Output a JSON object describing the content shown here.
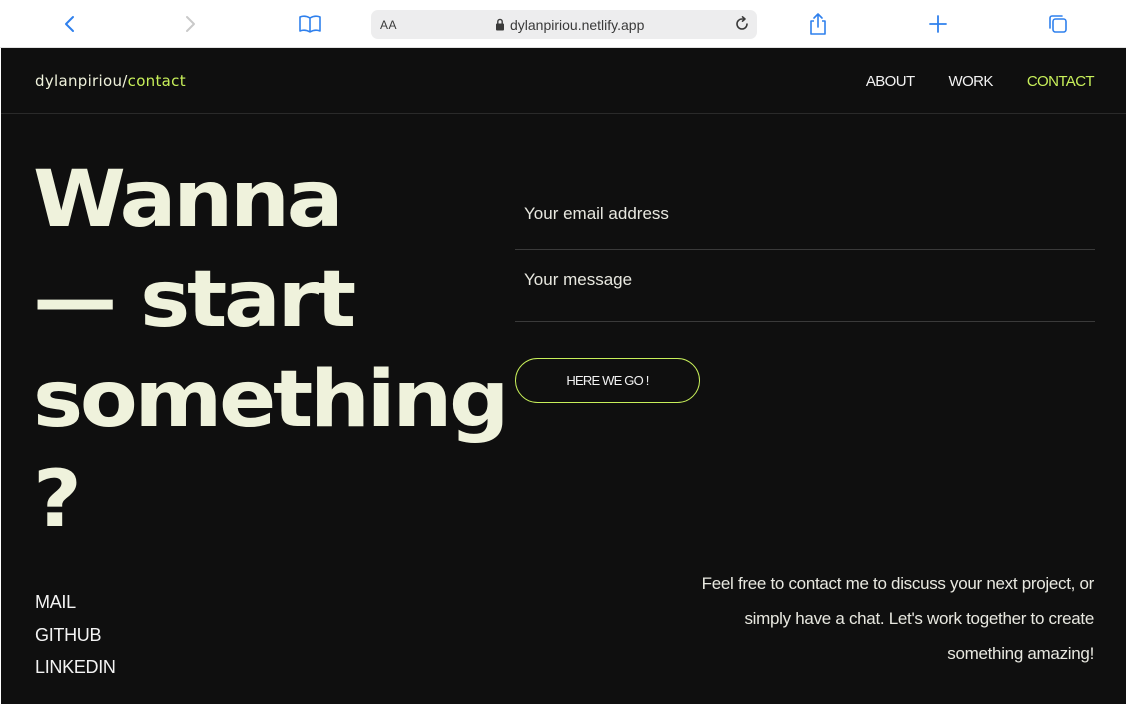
{
  "browser": {
    "aa_label": "AA",
    "url": "dylanpiriou.netlify.app",
    "icons": [
      "back-icon",
      "forward-icon",
      "reader-icon",
      "lock-icon",
      "reload-icon",
      "share-icon",
      "new-tab-icon",
      "tabs-icon"
    ],
    "accent_color": "#2f80ed"
  },
  "site": {
    "brand": {
      "name": "dylanpiriou",
      "slash": "/",
      "page": "contact"
    },
    "nav": [
      {
        "label": "ABOUT"
      },
      {
        "label": "WORK"
      },
      {
        "label": "CONTACT"
      }
    ],
    "headline": [
      "Wanna",
      "— start",
      "something",
      "?"
    ],
    "form": {
      "email_placeholder": "Your email address",
      "message_placeholder": "Your message",
      "submit_label": "HERE WE GO !"
    },
    "social": [
      {
        "label": "MAIL"
      },
      {
        "label": "GITHUB"
      },
      {
        "label": "LINKEDIN"
      }
    ],
    "blurb": "Feel free to contact me to discuss your next project, or simply have a chat. Let's work together to create something amazing!",
    "colors": {
      "background": "#0f0f0f",
      "text": "#eff2dc",
      "accent": "#c8f05a"
    }
  }
}
